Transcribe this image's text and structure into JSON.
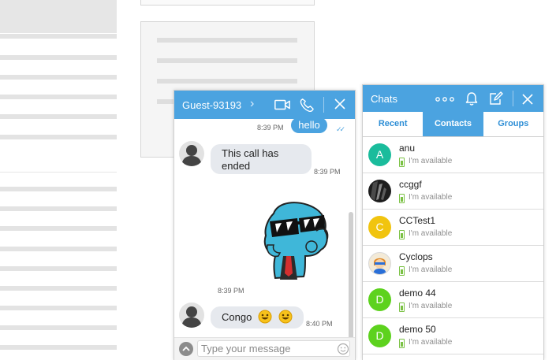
{
  "chat_window": {
    "title": "Guest-93193",
    "messages": [
      {
        "type": "outgoing",
        "text": "hello",
        "time": "8:39 PM"
      },
      {
        "type": "incoming",
        "text": "This call has ended",
        "time": "8:39 PM"
      },
      {
        "type": "incoming-sticker",
        "time": "8:39 PM"
      },
      {
        "type": "incoming",
        "text": "Congo",
        "emoji": "😃 😃",
        "time": "8:40 PM"
      }
    ],
    "composer": {
      "placeholder": "Type your message"
    }
  },
  "chats_panel": {
    "title": "Chats",
    "tabs": [
      {
        "label": "Recent",
        "active": false
      },
      {
        "label": "Contacts",
        "active": true
      },
      {
        "label": "Groups",
        "active": false
      }
    ],
    "contacts": [
      {
        "name": "anu",
        "initial": "A",
        "color": "#1abc9c",
        "status": "I'm available"
      },
      {
        "name": "ccggf",
        "initial": "",
        "color": "#222222",
        "status": "I'm available"
      },
      {
        "name": "CCTest1",
        "initial": "C",
        "color": "#f1c40f",
        "status": "I'm available"
      },
      {
        "name": "Cyclops",
        "initial": "",
        "color": "#f5e6c8",
        "status": "I'm available"
      },
      {
        "name": "demo 44",
        "initial": "D",
        "color": "#5dd21e",
        "status": "I'm available"
      },
      {
        "name": "demo 50",
        "initial": "D",
        "color": "#5dd21e",
        "status": "I'm available"
      }
    ]
  },
  "colors": {
    "accent": "#4ba3e0",
    "available": "#7ac143"
  }
}
